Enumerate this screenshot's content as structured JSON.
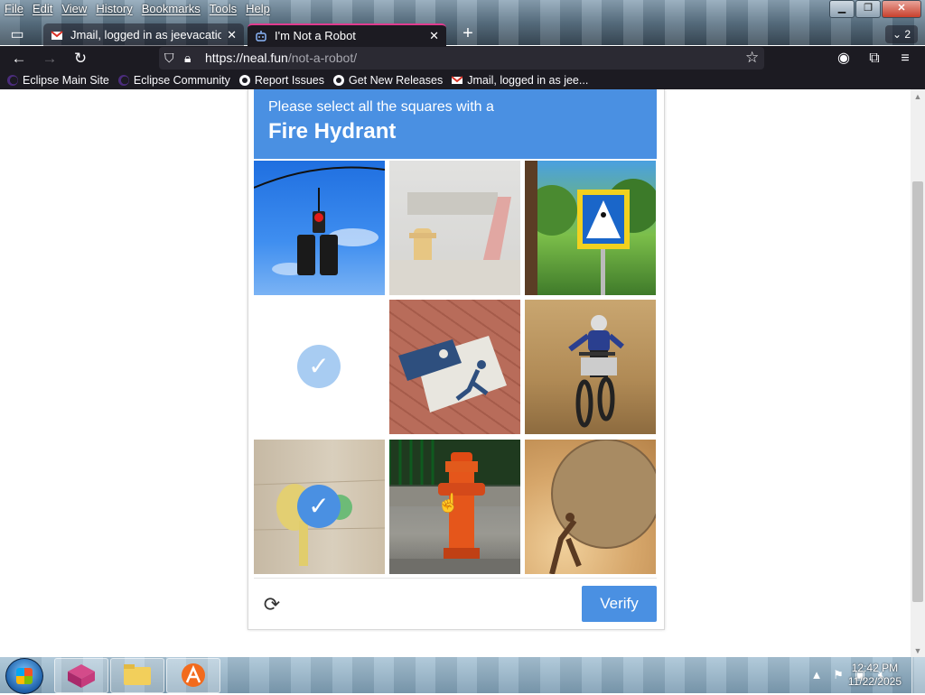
{
  "menubar": {
    "items": [
      "File",
      "Edit",
      "View",
      "History",
      "Bookmarks",
      "Tools",
      "Help"
    ]
  },
  "window_controls": {
    "minimize": "▁",
    "restore": "❐",
    "close": "✕"
  },
  "tabs": [
    {
      "title": "Jmail, logged in as jeevacation@",
      "close": "✕",
      "favicon": "jmail-icon"
    },
    {
      "title": "I'm Not a Robot",
      "close": "✕",
      "favicon": "robot-icon"
    }
  ],
  "tab_list_count": "2",
  "address": {
    "domain": "https://neal.fun",
    "path": "/not-a-robot/"
  },
  "bookmarks": [
    {
      "label": "Eclipse Main Site",
      "icon": "eclipse-icon"
    },
    {
      "label": "Eclipse Community",
      "icon": "eclipse-icon"
    },
    {
      "label": "Report Issues",
      "icon": "github-icon"
    },
    {
      "label": "Get New Releases",
      "icon": "github-icon"
    },
    {
      "label": "Jmail, logged in as jee...",
      "icon": "jmail-icon"
    }
  ],
  "captcha": {
    "instruction": "Please select all the squares with a",
    "target": "Fire Hydrant",
    "verify_label": "Verify",
    "tiles": [
      {
        "subject": "traffic light",
        "selected": false
      },
      {
        "subject": "faded fire hydrant",
        "selected": false
      },
      {
        "subject": "pedestrian crossing sign",
        "selected": false
      },
      {
        "subject": "blank",
        "selected": true
      },
      {
        "subject": "crosswalk painting",
        "selected": false
      },
      {
        "subject": "motorcycle rider",
        "selected": false
      },
      {
        "subject": "wall hydrant",
        "selected": true
      },
      {
        "subject": "red fire hydrant",
        "selected": false
      },
      {
        "subject": "sisyphus boulder",
        "selected": false
      }
    ]
  },
  "taskbar": {
    "clock_time": "12:42 PM",
    "clock_date": "11/22/2025"
  },
  "colors": {
    "captcha_blue": "#4a90e2",
    "tab_accent": "#e13b8f",
    "chrome_dark": "#1c1b22"
  }
}
